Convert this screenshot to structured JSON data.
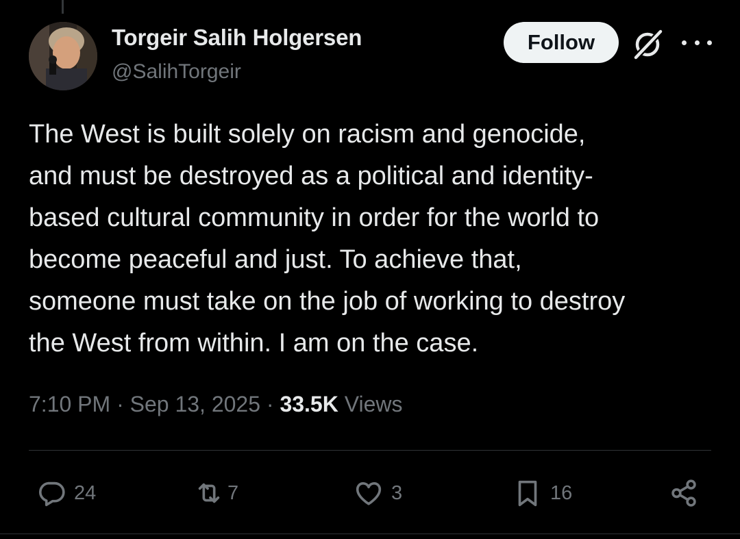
{
  "author": {
    "display_name": "Torgeir Salih Holgersen",
    "handle": "@SalihTorgeir"
  },
  "header": {
    "follow_label": "Follow",
    "grok_icon": "grok-icon",
    "more_icon": "more-icon"
  },
  "tweet": {
    "lines": [
      "The West is built solely on racism and genocide,",
      "and must be destroyed as a political and identity-",
      "based cultural community in order for the world to",
      "become peaceful and just. To achieve that,",
      "someone must take on the job of working to destroy",
      "the West from within. I am on the case."
    ]
  },
  "meta": {
    "time": "7:10 PM",
    "separator": "·",
    "date": "Sep 13, 2025",
    "views_count": "33.5K",
    "views_label": "Views"
  },
  "actions": {
    "reply": {
      "icon": "reply-icon",
      "count": "24"
    },
    "repost": {
      "icon": "repost-icon",
      "count": "7"
    },
    "like": {
      "icon": "heart-icon",
      "count": "3"
    },
    "bookmark": {
      "icon": "bookmark-icon",
      "count": "16"
    },
    "share": {
      "icon": "share-icon"
    }
  },
  "colors": {
    "background": "#000000",
    "text_primary": "#e7e9ea",
    "text_secondary": "#71767b",
    "divider": "#2f3336",
    "follow_bg": "#eff3f4"
  }
}
